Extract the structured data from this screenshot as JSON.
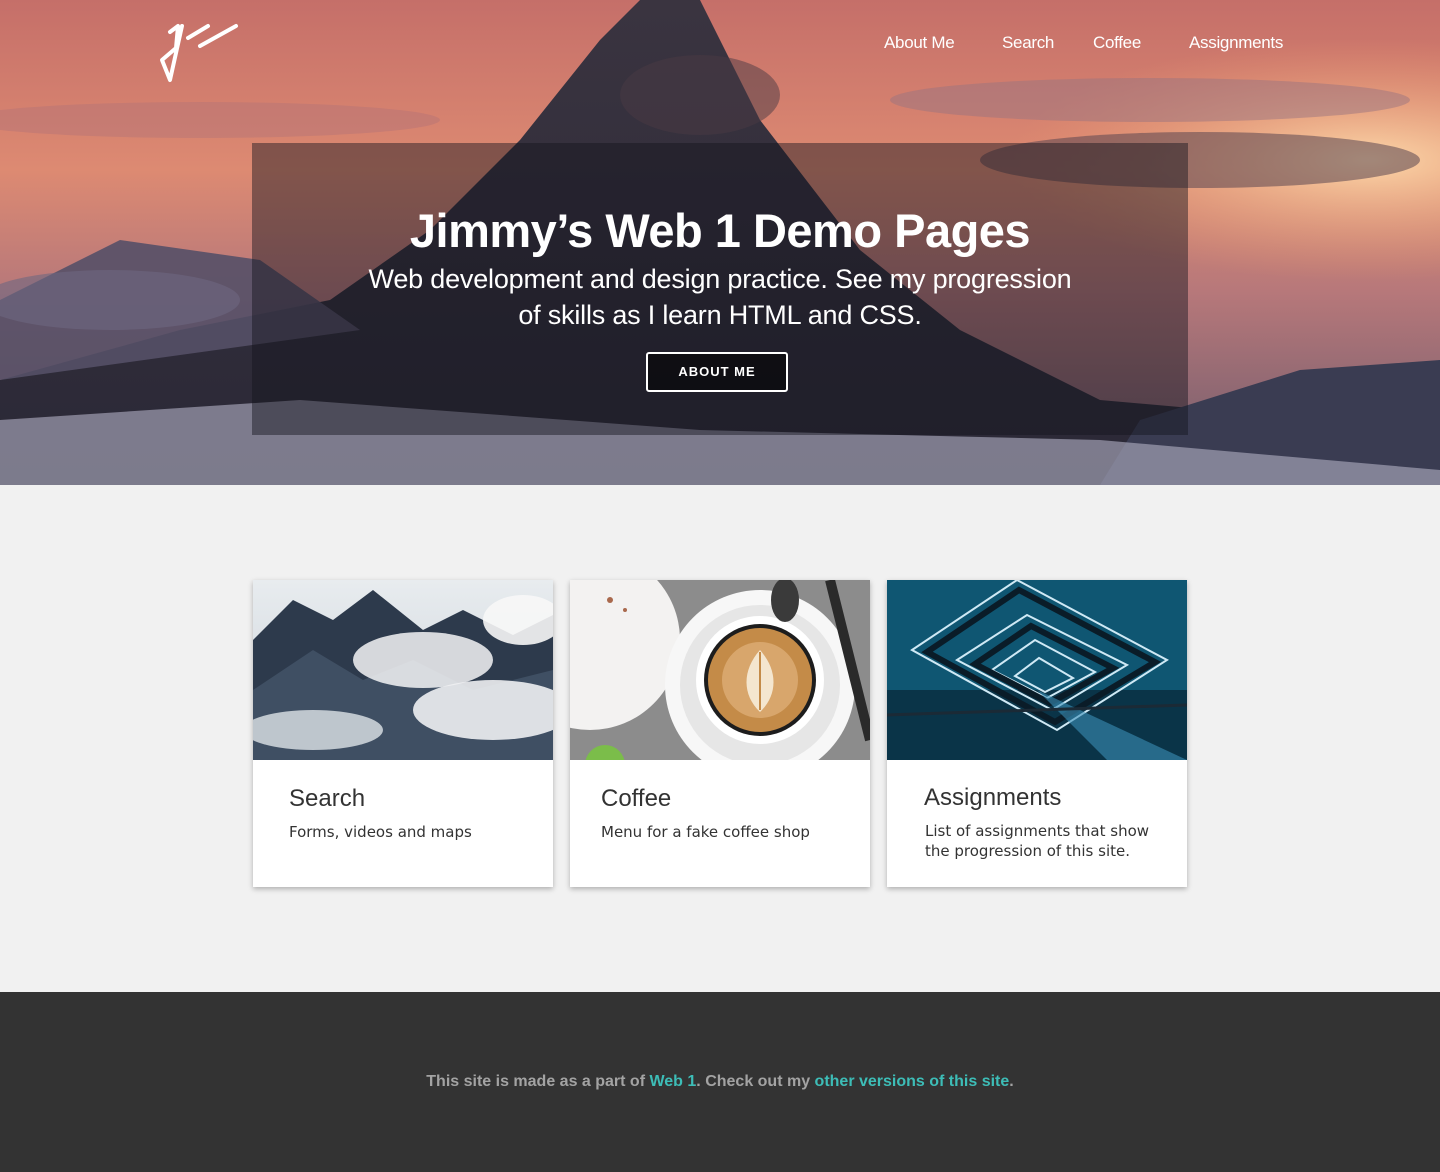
{
  "header": {
    "logo": "jw signature logo",
    "nav": [
      {
        "label": "About Me"
      },
      {
        "label": "Search"
      },
      {
        "label": "Coffee"
      },
      {
        "label": "Assignments"
      }
    ]
  },
  "hero": {
    "title": "Jimmy’s Web 1 Demo Pages",
    "subtitle_line1": "Web development and design practice. See my progression",
    "subtitle_line2": "of skills as I learn HTML and CSS.",
    "button_label": "ABOUT ME",
    "background": "mountain peak at sunset"
  },
  "cards": [
    {
      "title": "Search",
      "description": "Forms, videos and maps",
      "image": "cloudy mountains photo"
    },
    {
      "title": "Coffee",
      "description": "Menu for a fake coffee shop",
      "image": "latte art cup photo"
    },
    {
      "title": "Assignments",
      "description": "List of assignments that show the progression of this site.",
      "image": "lit walkway tunnel photo"
    }
  ],
  "footer": {
    "text_before": "This site is made as a part of ",
    "link1": "Web 1",
    "text_middle": ". Check out my ",
    "link2": "other versions of this site",
    "text_after": "."
  },
  "colors": {
    "link": "#3dbdb7",
    "footer_bg": "#333333",
    "page_bg": "#f1f1f1"
  }
}
